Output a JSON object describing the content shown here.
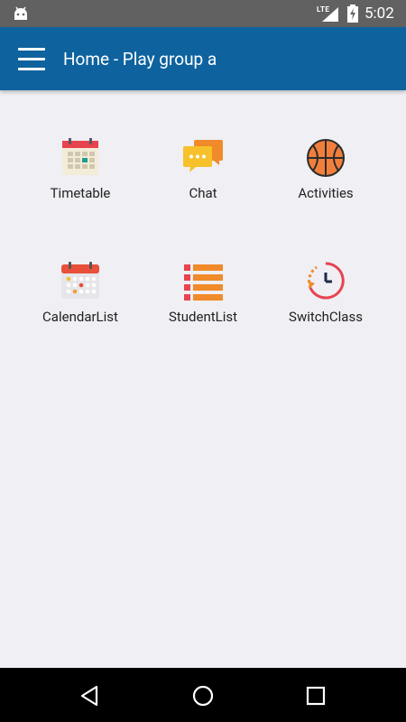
{
  "status_bar": {
    "network": "LTE",
    "time": "5:02",
    "icons": [
      "android-icon",
      "signal-icon",
      "battery-charging-icon"
    ]
  },
  "app_bar": {
    "title": "Home - Play group a",
    "menu_icon": "hamburger-menu-icon"
  },
  "tiles": [
    {
      "label": "Timetable",
      "icon": "timetable-calendar-icon"
    },
    {
      "label": "Chat",
      "icon": "chat-bubbles-icon"
    },
    {
      "label": "Activities",
      "icon": "basketball-icon"
    },
    {
      "label": "CalendarList",
      "icon": "calendar-list-icon"
    },
    {
      "label": "StudentList",
      "icon": "list-icon"
    },
    {
      "label": "SwitchClass",
      "icon": "clock-switch-icon"
    }
  ],
  "nav_bar": {
    "icons": [
      "back-triangle-icon",
      "home-circle-icon",
      "recents-square-icon"
    ]
  },
  "colors": {
    "app_bar": "#0e639f",
    "status_bar": "#616161",
    "background": "#efeff4",
    "nav_bar": "#000000"
  }
}
